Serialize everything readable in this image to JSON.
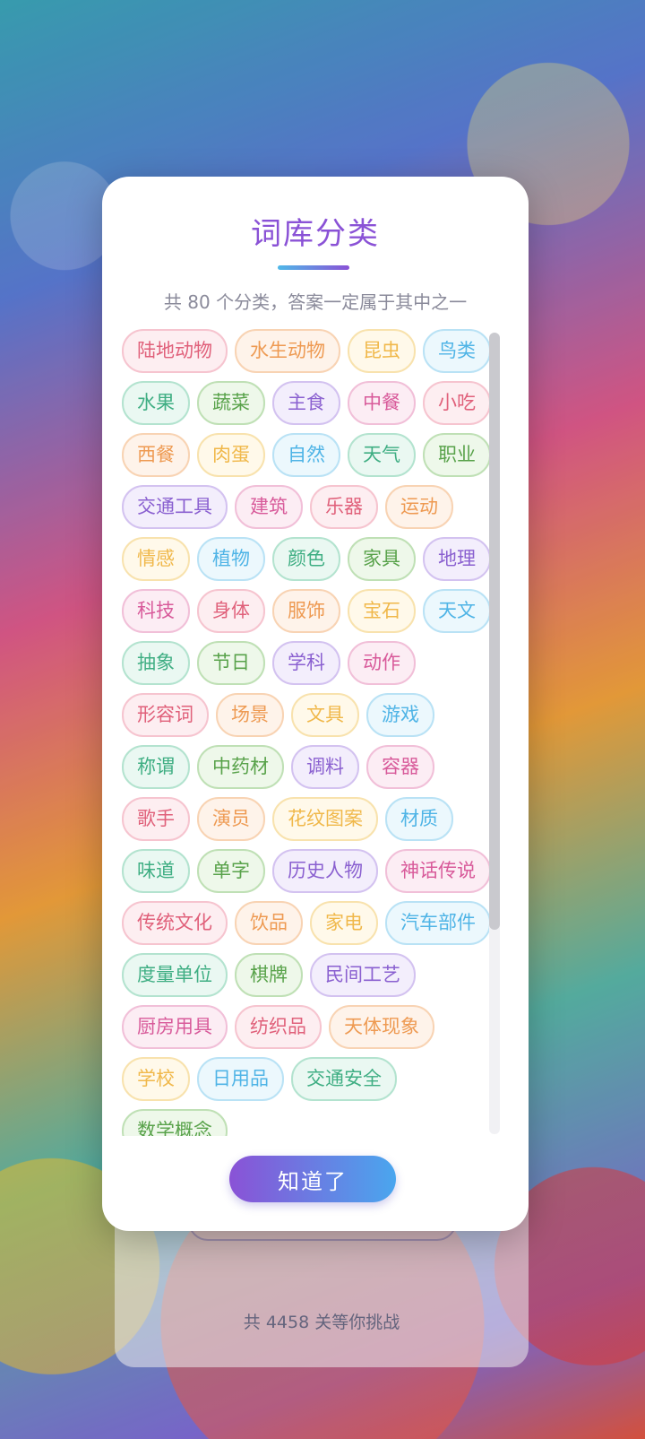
{
  "background": {
    "footer_text": "共 4458 关等你挑战"
  },
  "modal": {
    "title": "词库分类",
    "subtitle": "共 80 个分类，答案一定属于其中之一",
    "button_label": "知道了",
    "tags": [
      {
        "label": "陆地动物",
        "color": "pink"
      },
      {
        "label": "水生动物",
        "color": "orange"
      },
      {
        "label": "昆虫",
        "color": "yellow"
      },
      {
        "label": "鸟类",
        "color": "cyan"
      },
      {
        "label": "水果",
        "color": "green"
      },
      {
        "label": "蔬菜",
        "color": "olive"
      },
      {
        "label": "主食",
        "color": "purple"
      },
      {
        "label": "中餐",
        "color": "rose"
      },
      {
        "label": "小吃",
        "color": "pink"
      },
      {
        "label": "西餐",
        "color": "orange"
      },
      {
        "label": "肉蛋",
        "color": "yellow"
      },
      {
        "label": "自然",
        "color": "cyan"
      },
      {
        "label": "天气",
        "color": "green"
      },
      {
        "label": "职业",
        "color": "olive"
      },
      {
        "label": "交通工具",
        "color": "purple"
      },
      {
        "label": "建筑",
        "color": "rose"
      },
      {
        "label": "乐器",
        "color": "pink"
      },
      {
        "label": "运动",
        "color": "orange"
      },
      {
        "label": "情感",
        "color": "yellow"
      },
      {
        "label": "植物",
        "color": "cyan"
      },
      {
        "label": "颜色",
        "color": "green"
      },
      {
        "label": "家具",
        "color": "olive"
      },
      {
        "label": "地理",
        "color": "purple"
      },
      {
        "label": "科技",
        "color": "rose"
      },
      {
        "label": "身体",
        "color": "pink"
      },
      {
        "label": "服饰",
        "color": "orange"
      },
      {
        "label": "宝石",
        "color": "yellow"
      },
      {
        "label": "天文",
        "color": "cyan"
      },
      {
        "label": "抽象",
        "color": "green"
      },
      {
        "label": "节日",
        "color": "olive"
      },
      {
        "label": "学科",
        "color": "purple"
      },
      {
        "label": "动作",
        "color": "rose"
      },
      {
        "label": "形容词",
        "color": "pink"
      },
      {
        "label": "场景",
        "color": "orange"
      },
      {
        "label": "文具",
        "color": "yellow"
      },
      {
        "label": "游戏",
        "color": "cyan"
      },
      {
        "label": "称谓",
        "color": "green"
      },
      {
        "label": "中药材",
        "color": "olive"
      },
      {
        "label": "调料",
        "color": "purple"
      },
      {
        "label": "容器",
        "color": "rose"
      },
      {
        "label": "歌手",
        "color": "pink"
      },
      {
        "label": "演员",
        "color": "orange"
      },
      {
        "label": "花纹图案",
        "color": "yellow"
      },
      {
        "label": "材质",
        "color": "cyan"
      },
      {
        "label": "味道",
        "color": "green"
      },
      {
        "label": "单字",
        "color": "olive"
      },
      {
        "label": "历史人物",
        "color": "purple"
      },
      {
        "label": "神话传说",
        "color": "rose"
      },
      {
        "label": "传统文化",
        "color": "pink"
      },
      {
        "label": "饮品",
        "color": "orange"
      },
      {
        "label": "家电",
        "color": "yellow"
      },
      {
        "label": "汽车部件",
        "color": "cyan"
      },
      {
        "label": "度量单位",
        "color": "green"
      },
      {
        "label": "棋牌",
        "color": "olive"
      },
      {
        "label": "民间工艺",
        "color": "purple"
      },
      {
        "label": "厨房用具",
        "color": "rose"
      },
      {
        "label": "纺织品",
        "color": "pink"
      },
      {
        "label": "天体现象",
        "color": "orange"
      },
      {
        "label": "学校",
        "color": "yellow"
      },
      {
        "label": "日用品",
        "color": "cyan"
      },
      {
        "label": "交通安全",
        "color": "green"
      },
      {
        "label": "数学概念",
        "color": "olive"
      }
    ]
  },
  "colors": {
    "title": "#8a52d6",
    "button_start": "#8a52d6",
    "button_end": "#4aa6ee"
  }
}
